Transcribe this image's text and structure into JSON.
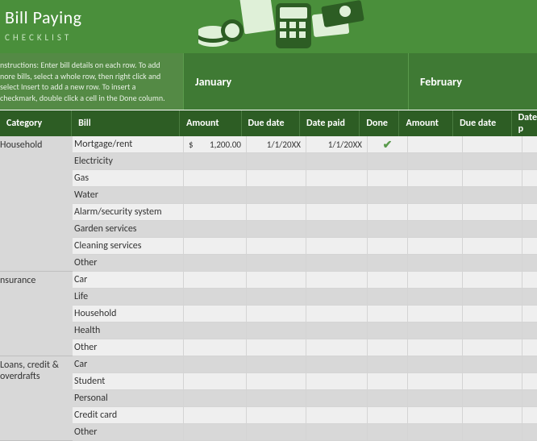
{
  "banner": {
    "title": "Bill Paying",
    "subtitle": "CHECKLIST"
  },
  "instructions": "nstructions: Enter bill details on each row. To add nore bills, select a whole row, then right click and select Insert to add a new row. To insert a checkmark, double click a cell in the Done column.",
  "months": {
    "jan": "January",
    "feb": "February"
  },
  "headers": {
    "category": "Category",
    "bill": "Bill",
    "amount": "Amount",
    "due": "Due date",
    "paid": "Date paid",
    "done": "Done",
    "amount2": "Amount",
    "due2": "Due date",
    "paid2": "Date p"
  },
  "categories": [
    {
      "name": "Household",
      "bills": [
        "Mortgage/rent",
        "Electricity",
        "Gas",
        "Water",
        "Alarm/security system",
        "Garden services",
        "Cleaning services",
        "Other"
      ]
    },
    {
      "name": "nsurance",
      "bills": [
        "Car",
        "Life",
        "Household",
        "Health",
        "Other"
      ]
    },
    {
      "name": "Loans, credit & overdrafts",
      "bills": [
        "Car",
        "Student",
        "Personal",
        "Credit card",
        "Other"
      ]
    }
  ],
  "data": {
    "0": {
      "currency": "$",
      "amount": "1,200.00",
      "due": "1/1/20XX",
      "paid": "1/1/20XX",
      "done": true
    }
  }
}
